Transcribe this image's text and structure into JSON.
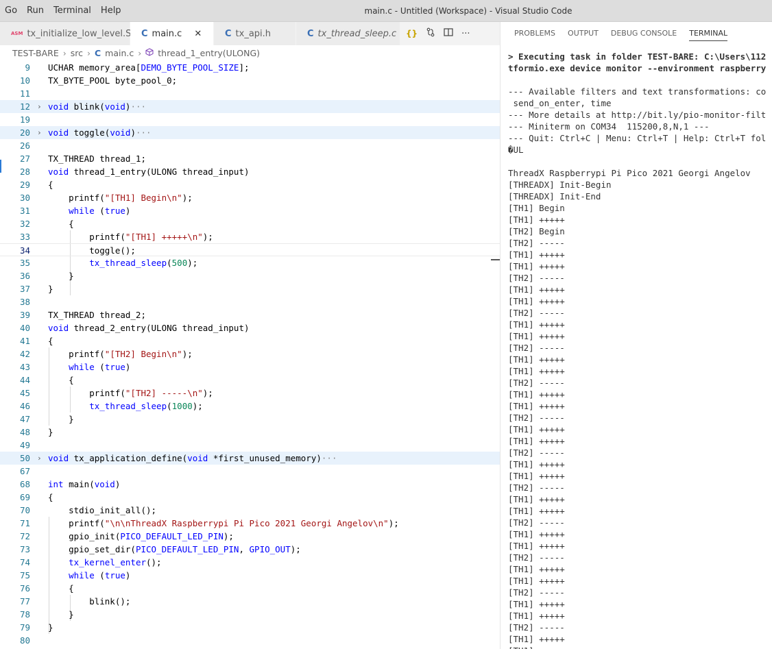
{
  "menu": [
    "Go",
    "Run",
    "Terminal",
    "Help"
  ],
  "window_title": "main.c - Untitled (Workspace) - Visual Studio Code",
  "tabs": [
    {
      "icon": "ASM",
      "label": "tx_initialize_low_level.S"
    },
    {
      "icon": "C",
      "label": "main.c",
      "close": "✕"
    },
    {
      "icon": "C",
      "label": "tx_api.h"
    },
    {
      "icon": "C",
      "label": "tx_thread_sleep.c"
    }
  ],
  "tab_actions": {
    "braces": "{}",
    "more": "···"
  },
  "breadcrumb": {
    "root": "TEST-BARE",
    "folder": "src",
    "file_icon": "C",
    "file": "main.c",
    "symbol": "thread_1_entry(ULONG)"
  },
  "code_lines": [
    {
      "n": "9",
      "t": "UCHAR memory_area[DEMO_BYTE_POOL_SIZE];"
    },
    {
      "n": "10",
      "t": "TX_BYTE_POOL byte_pool_0;"
    },
    {
      "n": "11",
      "t": ""
    },
    {
      "n": "12",
      "t": "void blink(void)",
      "folded": true
    },
    {
      "n": "19",
      "t": ""
    },
    {
      "n": "20",
      "t": "void toggle(void)",
      "folded": true
    },
    {
      "n": "26",
      "t": ""
    },
    {
      "n": "27",
      "t": "TX_THREAD thread_1;"
    },
    {
      "n": "28",
      "t": "void thread_1_entry(ULONG thread_input)"
    },
    {
      "n": "29",
      "t": "{"
    },
    {
      "n": "30",
      "t": "    printf(\"[TH1] Begin\\n\");"
    },
    {
      "n": "31",
      "t": "    while (true)"
    },
    {
      "n": "32",
      "t": "    {"
    },
    {
      "n": "33",
      "t": "        printf(\"[TH1] +++++\\n\");"
    },
    {
      "n": "34",
      "t": "        toggle();"
    },
    {
      "n": "35",
      "t": "        tx_thread_sleep(500);"
    },
    {
      "n": "36",
      "t": "    }"
    },
    {
      "n": "37",
      "t": "}"
    },
    {
      "n": "38",
      "t": ""
    },
    {
      "n": "39",
      "t": "TX_THREAD thread_2;"
    },
    {
      "n": "40",
      "t": "void thread_2_entry(ULONG thread_input)"
    },
    {
      "n": "41",
      "t": "{"
    },
    {
      "n": "42",
      "t": "    printf(\"[TH2] Begin\\n\");"
    },
    {
      "n": "43",
      "t": "    while (true)"
    },
    {
      "n": "44",
      "t": "    {"
    },
    {
      "n": "45",
      "t": "        printf(\"[TH2] -----\\n\");"
    },
    {
      "n": "46",
      "t": "        tx_thread_sleep(1000);"
    },
    {
      "n": "47",
      "t": "    }"
    },
    {
      "n": "48",
      "t": "}"
    },
    {
      "n": "49",
      "t": ""
    },
    {
      "n": "50",
      "t": "void tx_application_define(void *first_unused_memory)",
      "folded": true
    },
    {
      "n": "67",
      "t": ""
    },
    {
      "n": "68",
      "t": "int main(void)"
    },
    {
      "n": "69",
      "t": "{"
    },
    {
      "n": "70",
      "t": "    stdio_init_all();"
    },
    {
      "n": "71",
      "t": "    printf(\"\\n\\nThreadX Raspberrypi Pi Pico 2021 Georgi Angelov\\n\");"
    },
    {
      "n": "72",
      "t": "    gpio_init(PICO_DEFAULT_LED_PIN);"
    },
    {
      "n": "73",
      "t": "    gpio_set_dir(PICO_DEFAULT_LED_PIN, GPIO_OUT);"
    },
    {
      "n": "74",
      "t": "    tx_kernel_enter();"
    },
    {
      "n": "75",
      "t": "    while (true)"
    },
    {
      "n": "76",
      "t": "    {"
    },
    {
      "n": "77",
      "t": "        blink();"
    },
    {
      "n": "78",
      "t": "    }"
    },
    {
      "n": "79",
      "t": "}"
    },
    {
      "n": "80",
      "t": ""
    }
  ],
  "current_line": "34",
  "fold_ellipsis": "···",
  "panel_tabs": [
    "PROBLEMS",
    "OUTPUT",
    "DEBUG CONSOLE",
    "TERMINAL"
  ],
  "active_panel_tab": "TERMINAL",
  "terminal_lines": [
    {
      "t": "> Executing task in folder TEST-BARE: C:\\Users\\112",
      "bold": true
    },
    {
      "t": "tformio.exe device monitor --environment raspberry",
      "bold": true
    },
    {
      "t": ""
    },
    {
      "t": "--- Available filters and text transformations: co"
    },
    {
      "t": " send_on_enter, time"
    },
    {
      "t": "--- More details at http://bit.ly/pio-monitor-filt"
    },
    {
      "t": "--- Miniterm on COM34  115200,8,N,1 ---"
    },
    {
      "t": "--- Quit: Ctrl+C | Menu: Ctrl+T | Help: Ctrl+T fol"
    },
    {
      "t": "�UL"
    },
    {
      "t": ""
    },
    {
      "t": "ThreadX Raspberrypi Pi Pico 2021 Georgi Angelov"
    },
    {
      "t": "[THREADX] Init-Begin"
    },
    {
      "t": "[THREADX] Init-End"
    },
    {
      "t": "[TH1] Begin"
    },
    {
      "t": "[TH1] +++++"
    },
    {
      "t": "[TH2] Begin"
    },
    {
      "t": "[TH2] -----"
    },
    {
      "t": "[TH1] +++++"
    },
    {
      "t": "[TH1] +++++"
    },
    {
      "t": "[TH2] -----"
    },
    {
      "t": "[TH1] +++++"
    },
    {
      "t": "[TH1] +++++"
    },
    {
      "t": "[TH2] -----"
    },
    {
      "t": "[TH1] +++++"
    },
    {
      "t": "[TH1] +++++"
    },
    {
      "t": "[TH2] -----"
    },
    {
      "t": "[TH1] +++++"
    },
    {
      "t": "[TH1] +++++"
    },
    {
      "t": "[TH2] -----"
    },
    {
      "t": "[TH1] +++++"
    },
    {
      "t": "[TH1] +++++"
    },
    {
      "t": "[TH2] -----"
    },
    {
      "t": "[TH1] +++++"
    },
    {
      "t": "[TH1] +++++"
    },
    {
      "t": "[TH2] -----"
    },
    {
      "t": "[TH1] +++++"
    },
    {
      "t": "[TH1] +++++"
    },
    {
      "t": "[TH2] -----"
    },
    {
      "t": "[TH1] +++++"
    },
    {
      "t": "[TH1] +++++"
    },
    {
      "t": "[TH2] -----"
    },
    {
      "t": "[TH1] +++++"
    },
    {
      "t": "[TH1] +++++"
    },
    {
      "t": "[TH2] -----"
    },
    {
      "t": "[TH1] +++++"
    },
    {
      "t": "[TH1] +++++"
    },
    {
      "t": "[TH2] -----"
    },
    {
      "t": "[TH1] +++++"
    },
    {
      "t": "[TH1] +++++"
    },
    {
      "t": "[TH2] -----"
    },
    {
      "t": "[TH1] +++++"
    },
    {
      "t": "[TH1] +++++"
    }
  ]
}
